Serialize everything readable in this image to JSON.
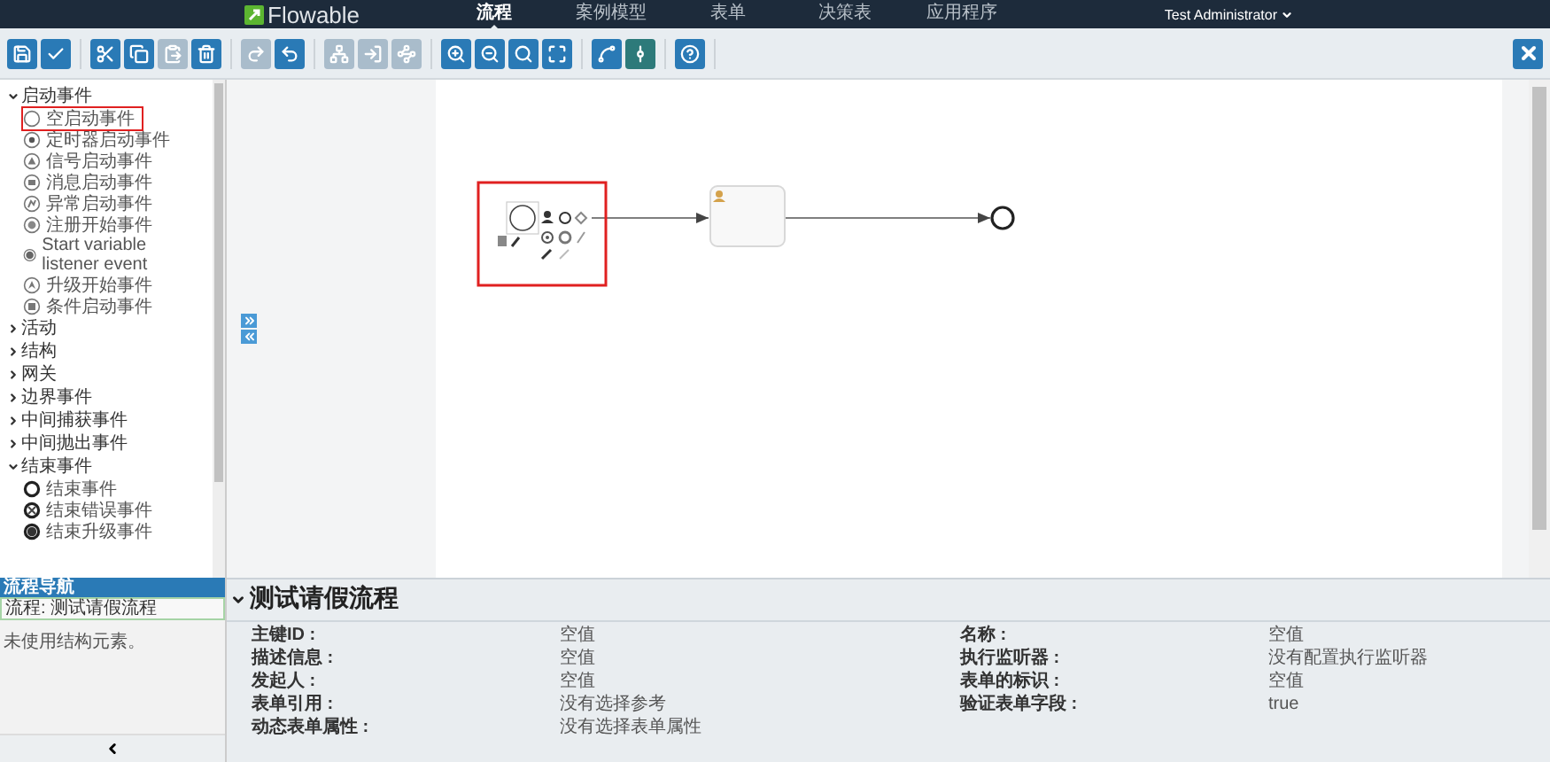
{
  "navbar": {
    "logo": "Flowable",
    "items": [
      {
        "label": "流程",
        "selected": true
      },
      {
        "label": "案例模型",
        "selected": false
      },
      {
        "label": "表单",
        "selected": false
      },
      {
        "label": "决策表",
        "selected": false
      },
      {
        "label": "应用程序",
        "selected": false
      }
    ],
    "user": "Test Administrator"
  },
  "toolbar": {
    "groups": [
      [
        {
          "kind": "save",
          "disabled": false,
          "selected": false
        },
        {
          "kind": "validate",
          "disabled": false,
          "selected": false
        }
      ],
      [
        {
          "kind": "cut",
          "disabled": false,
          "selected": false
        },
        {
          "kind": "copy",
          "disabled": false,
          "selected": false
        },
        {
          "kind": "paste",
          "disabled": true,
          "selected": false
        },
        {
          "kind": "delete",
          "disabled": false,
          "selected": false
        }
      ],
      [
        {
          "kind": "redo",
          "disabled": true,
          "selected": false
        },
        {
          "kind": "undo",
          "disabled": false,
          "selected": false
        }
      ],
      [
        {
          "kind": "align",
          "disabled": true,
          "selected": false
        },
        {
          "kind": "attach",
          "disabled": true,
          "selected": false
        },
        {
          "kind": "route",
          "disabled": true,
          "selected": false
        }
      ],
      [
        {
          "kind": "zoom-in",
          "disabled": false,
          "selected": false
        },
        {
          "kind": "zoom-out",
          "disabled": false,
          "selected": false
        },
        {
          "kind": "zoom-actual",
          "disabled": false,
          "selected": false
        },
        {
          "kind": "zoom-fit",
          "disabled": false,
          "selected": false
        }
      ],
      [
        {
          "kind": "bendpoint-add",
          "disabled": false,
          "selected": false
        },
        {
          "kind": "bendpoint-remove",
          "disabled": false,
          "selected": true
        }
      ],
      [
        {
          "kind": "help",
          "disabled": false,
          "selected": false
        }
      ]
    ],
    "close": {
      "kind": "close"
    }
  },
  "palette": {
    "groups": [
      {
        "label": "启动事件",
        "expanded": true,
        "items": [
          {
            "label": "空启动事件",
            "kind": "none",
            "selected": true
          },
          {
            "label": "定时器启动事件",
            "kind": "timer",
            "selected": false
          },
          {
            "label": "信号启动事件",
            "kind": "signal",
            "selected": false
          },
          {
            "label": "消息启动事件",
            "kind": "message",
            "selected": false
          },
          {
            "label": "异常启动事件",
            "kind": "error",
            "selected": false
          },
          {
            "label": "注册开始事件",
            "kind": "registry",
            "selected": false
          },
          {
            "label": "Start variable listener event",
            "kind": "variable",
            "selected": false
          },
          {
            "label": "升级开始事件",
            "kind": "escalation",
            "selected": false
          },
          {
            "label": "条件启动事件",
            "kind": "conditional",
            "selected": false
          }
        ]
      },
      {
        "label": "活动",
        "expanded": false
      },
      {
        "label": "结构",
        "expanded": false
      },
      {
        "label": "网关",
        "expanded": false
      },
      {
        "label": "边界事件",
        "expanded": false
      },
      {
        "label": "中间捕获事件",
        "expanded": false
      },
      {
        "label": "中间抛出事件",
        "expanded": false
      },
      {
        "label": "结束事件",
        "expanded": true,
        "items": [
          {
            "label": "结束事件",
            "kind": "end",
            "selected": false
          },
          {
            "label": "结束错误事件",
            "kind": "end-error",
            "selected": false
          },
          {
            "label": "结束升级事件",
            "kind": "end-escalation",
            "selected": false
          }
        ]
      }
    ]
  },
  "navigator": {
    "title": "流程导航",
    "current": "流程: 测试请假流程",
    "note": "未使用结构元素。"
  },
  "diagram": {
    "nodes": [
      {
        "kind": "start-event",
        "selected": true
      },
      {
        "kind": "user-task",
        "selected": false
      },
      {
        "kind": "end-event",
        "selected": false
      }
    ]
  },
  "properties": {
    "title": "测试请假流程",
    "expanded": true,
    "fields": [
      {
        "label": "主键ID :",
        "value": "空值"
      },
      {
        "label": "名称 :",
        "value": "空值"
      },
      {
        "label": "描述信息 :",
        "value": "空值"
      },
      {
        "label": "执行监听器 :",
        "value": "没有配置执行监听器"
      },
      {
        "label": "发起人 :",
        "value": "空值"
      },
      {
        "label": "表单的标识 :",
        "value": "空值"
      },
      {
        "label": "表单引用 :",
        "value": "没有选择参考"
      },
      {
        "label": "验证表单字段 :",
        "value": "true"
      },
      {
        "label": "动态表单属性 :",
        "value": "没有选择表单属性"
      }
    ]
  }
}
